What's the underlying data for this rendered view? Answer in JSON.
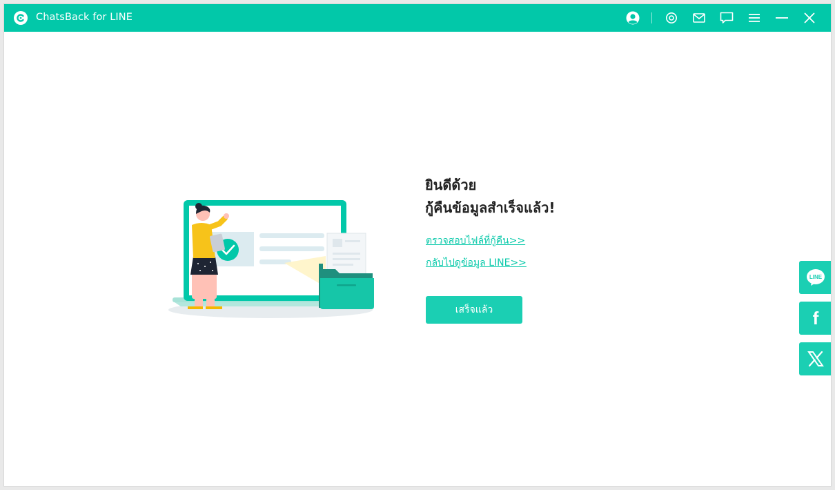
{
  "window": {
    "title": "ChatsBack for LINE"
  },
  "titlebar": {
    "icons": [
      "user-avatar-icon",
      "settings-icon",
      "mail-icon",
      "feedback-icon",
      "menu-icon",
      "minimize-icon",
      "close-icon"
    ]
  },
  "main": {
    "headline_line1": "ยินดีด้วย",
    "headline_line2": "กู้คืนข้อมูลสำเร็จแล้ว!",
    "link_view_files": "ตรวจสอบไฟล์ที่กู้คืน>>",
    "link_back_to_line": "กลับไปดูข้อมูล LINE>>",
    "done_button": "เสร็จแล้ว"
  },
  "social": {
    "line_label": "LINE",
    "items": [
      "line-icon",
      "facebook-icon",
      "x-icon"
    ]
  },
  "colors": {
    "accent": "#02c8a9",
    "button": "#1bcfb3",
    "link": "#09c9aa"
  }
}
